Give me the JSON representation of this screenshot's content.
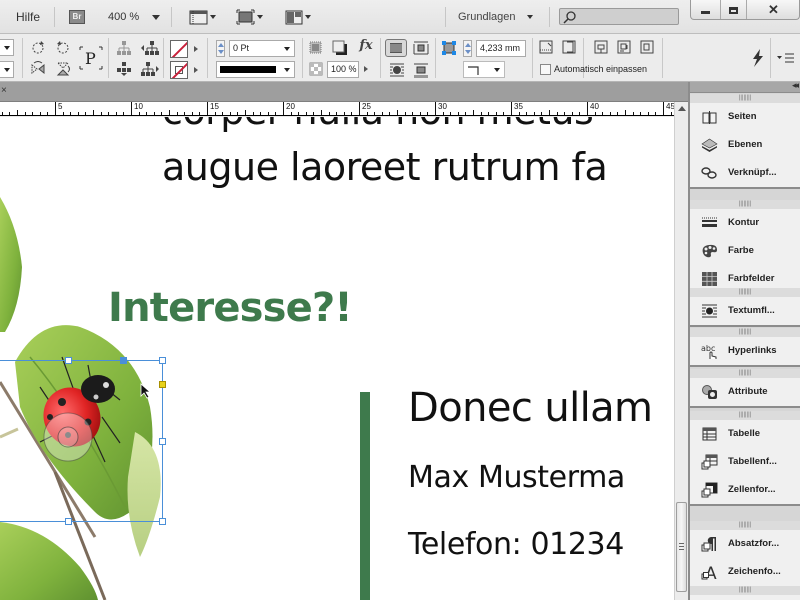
{
  "menubar": {
    "help_label": "Hilfe",
    "bridge_label": "Br",
    "zoom_level": "400 %",
    "workspace_label": "Grundlagen",
    "search_placeholder": "",
    "icons": [
      "view-options-icon",
      "screen-mode-icon",
      "arrange-documents-icon",
      "search-icon",
      "minimize-icon",
      "maximize-icon",
      "close-icon"
    ]
  },
  "controlbar": {
    "stroke_weight": "0 Pt",
    "opacity": "100 %",
    "corner_size": "4,233 mm",
    "auto_fit_label": "Automatisch einpassen",
    "auto_fit_checked": false,
    "icons": [
      "rotate-cw-icon",
      "rotate-ccw-icon",
      "flip-horizontal-icon",
      "flip-vertical-icon",
      "reference-point-icon",
      "select-container-icon",
      "select-previous-icon",
      "select-content-icon",
      "select-next-icon",
      "fill-swatch-icon",
      "stroke-swatch-icon",
      "drop-shadow-icon",
      "shadow-icon",
      "effects-icon",
      "text-wrap-none-icon",
      "text-wrap-bounding-icon",
      "text-wrap-object-icon",
      "text-wrap-jump-icon",
      "corner-options-icon",
      "fit-content-frame-icon",
      "fit-frame-content-icon",
      "center-content-icon",
      "fill-frame-icon",
      "fit-content-proportional-icon",
      "quick-apply-icon",
      "panel-menu-icon"
    ]
  },
  "ruler": {
    "labels": [
      "5",
      "10",
      "15",
      "20",
      "25",
      "30",
      "35",
      "40",
      "45"
    ]
  },
  "document": {
    "line1": "corper nulla non metus",
    "line2": "augue laoreet rutrum fa",
    "heading": "Interesse?!",
    "contact_line1": "Donec ullam",
    "contact_line2": "Max Musterma",
    "contact_line3": "Telefon: 01234",
    "accent_color": "#3e7a4c",
    "image_description": "ladybug on green leaf"
  },
  "panels": {
    "groups": [
      {
        "items": [
          {
            "label": "Seiten",
            "icon": "pages-icon"
          },
          {
            "label": "Ebenen",
            "icon": "layers-icon"
          },
          {
            "label": "Verknüpf...",
            "icon": "links-icon"
          }
        ]
      },
      {
        "items": [
          {
            "label": "Kontur",
            "icon": "stroke-icon"
          },
          {
            "label": "Farbe",
            "icon": "color-icon"
          },
          {
            "label": "Farbfelder",
            "icon": "swatches-icon"
          }
        ]
      },
      {
        "items": [
          {
            "label": "Textumfl...",
            "icon": "text-wrap-icon"
          }
        ]
      },
      {
        "items": [
          {
            "label": "Hyperlinks",
            "icon": "hyperlinks-icon"
          }
        ]
      },
      {
        "items": [
          {
            "label": "Attribute",
            "icon": "attributes-icon"
          }
        ]
      },
      {
        "items": [
          {
            "label": "Tabelle",
            "icon": "table-icon"
          },
          {
            "label": "Tabellenf...",
            "icon": "table-styles-icon"
          },
          {
            "label": "Zellenfor...",
            "icon": "cell-styles-icon"
          }
        ]
      },
      {
        "items": [
          {
            "label": "Absatzfor...",
            "icon": "paragraph-styles-icon"
          },
          {
            "label": "Zeichenfo...",
            "icon": "character-styles-icon"
          }
        ]
      }
    ]
  }
}
